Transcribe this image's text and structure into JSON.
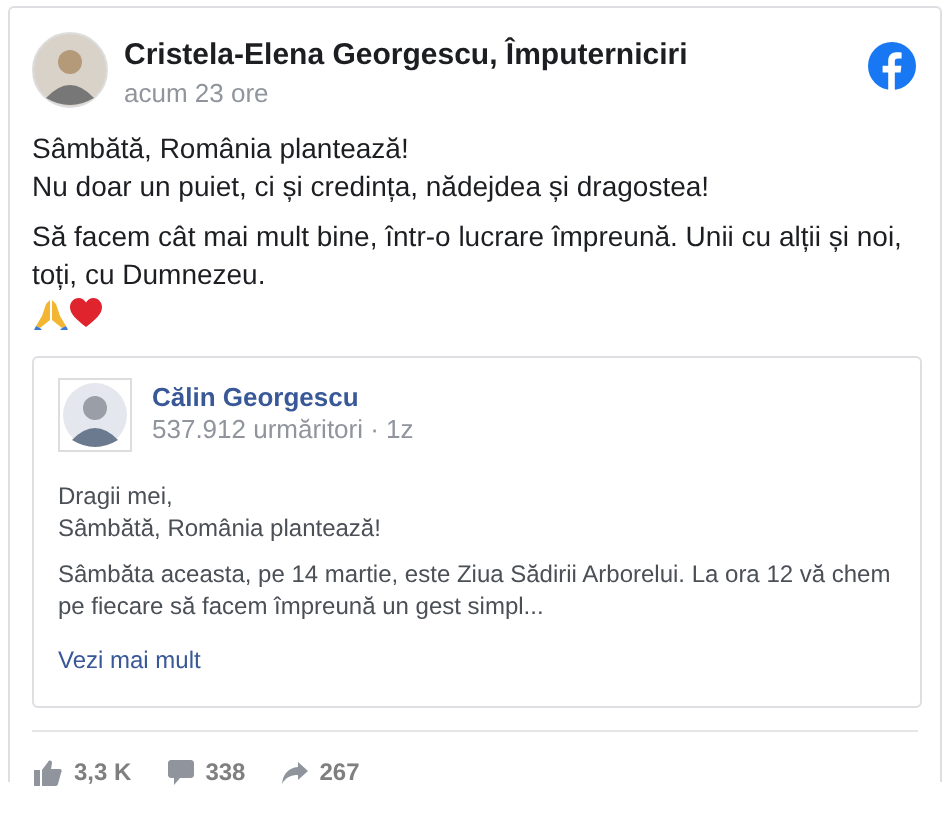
{
  "post": {
    "author": "Cristela-Elena Georgescu, Împuterniciri",
    "time": "acum 23 ore",
    "paragraphs": [
      [
        "Sâmbătă, România plantează!",
        "Nu doar un puiet, ci și credința, nădejdea și dragostea!"
      ],
      [
        "Să facem cât mai mult bine, într-o lucrare împreună. Unii cu alții și noi, toți, cu Dumnezeu."
      ]
    ],
    "emoji": [
      {
        "kind": "pray"
      },
      {
        "kind": "heart"
      }
    ]
  },
  "shared": {
    "author": "Călin Georgescu",
    "meta": "537.912 urmăritori · 1z",
    "paragraphs": [
      [
        "Dragii mei,",
        "Sâmbătă, România plantează!"
      ],
      [
        "Sâmbăta aceasta, pe 14 martie, este Ziua Sădirii Arborelui. La ora 12 vă chem pe fiecare să facem împreună un gest simpl..."
      ]
    ],
    "see_more": "Vezi mai mult"
  },
  "stats": [
    {
      "kind": "like",
      "count": "3,3 K"
    },
    {
      "kind": "comment",
      "count": "338"
    },
    {
      "kind": "share",
      "count": "267"
    }
  ]
}
